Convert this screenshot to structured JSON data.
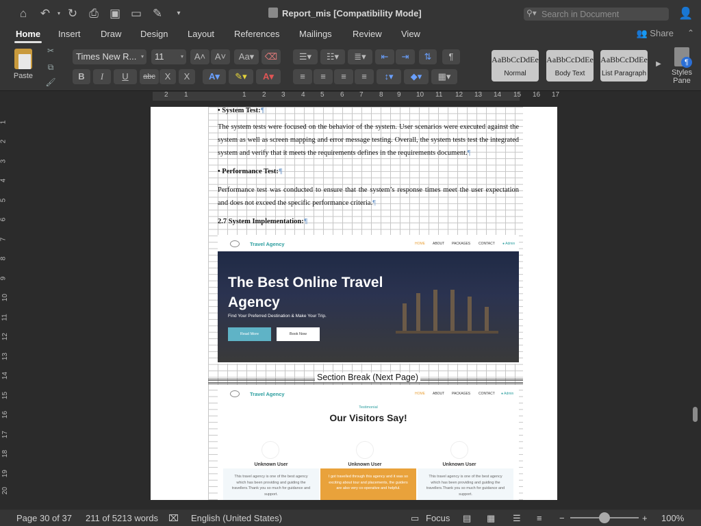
{
  "window": {
    "title": "Report_mis [Compatibility Mode]",
    "search_placeholder": "Search in Document"
  },
  "tabs": [
    "Home",
    "Insert",
    "Draw",
    "Design",
    "Layout",
    "References",
    "Mailings",
    "Review",
    "View"
  ],
  "active_tab": "Home",
  "share_label": "Share",
  "ribbon": {
    "paste_label": "Paste",
    "font_name": "Times New R...",
    "font_size": "11",
    "bold": "B",
    "italic": "I",
    "underline": "U",
    "strikethrough": "abc",
    "subscript": "X",
    "superscript": "X",
    "styles": [
      {
        "preview": "AaBbCcDdEe",
        "name": "Normal"
      },
      {
        "preview": "AaBbCcDdEe",
        "name": "Body Text"
      },
      {
        "preview": "AaBbCcDdEe",
        "name": "List Paragraph"
      }
    ],
    "styles_pane_line1": "Styles",
    "styles_pane_line2": "Pane"
  },
  "ruler_numbers": [
    "2",
    "1",
    "1",
    "2",
    "3",
    "4",
    "5",
    "6",
    "7",
    "8",
    "9",
    "10",
    "11",
    "12",
    "13",
    "14",
    "15",
    "16",
    "17"
  ],
  "vruler_numbers": [
    "1",
    "2",
    "3",
    "4",
    "5",
    "6",
    "7",
    "8",
    "9",
    "10",
    "11",
    "12",
    "13",
    "14",
    "15",
    "16",
    "17",
    "18",
    "19",
    "20"
  ],
  "document": {
    "system_test_heading": "• System Test:",
    "system_test_body": "The system tests were focused on the behavior of the system. User scenarios were executed against the system as well as screen mapping and error message testing. Overall, the system tests test the integrated system and verify that it meets the requirements defines in the requirements document.",
    "perf_test_heading": "• Performance Test:",
    "perf_test_body": "Performance test was conducted to ensure that the system’s response times meet the user expectation and does not exceed the specific performance criteria.",
    "impl_heading": "2.7 System Implementation:",
    "section_break": "Section Break (Next Page)",
    "pilcrow": "¶"
  },
  "website_shot1": {
    "brand": "Travel Agency",
    "nav_links": [
      "HOME",
      "ABOUT",
      "PACKAGES",
      "CONTACT"
    ],
    "admin": "Admin",
    "hero_title": "The Best Online Travel Agency",
    "hero_subtitle": "Find Your Preferred Destination & Make Your Trip.",
    "btn_read_more": "Read More",
    "btn_book_now": "Book Now"
  },
  "website_shot2": {
    "brand": "Travel Agency",
    "nav_links": [
      "HOME",
      "ABOUT",
      "PACKAGES",
      "CONTACT"
    ],
    "admin": "Admin",
    "section_label": "Testimonial",
    "section_title": "Our Visitors Say!",
    "users": [
      "Unknown User",
      "Unknown User",
      "Unknown User"
    ],
    "cards": [
      "This travel agency is one of the best agency which has been providing and guiding the travellers.Thank you so much for guidance and support.",
      "I got travelled through this agency and it was so exciting about tour and placements, the guiders are also very co-operative and helpful.",
      "This travel agency is one of the best agency which has been providing and guiding the travellers.Thank you so much for guidance and support."
    ]
  },
  "status": {
    "page": "Page 30 of 37",
    "words": "211 of 5213 words",
    "language": "English (United States)",
    "focus": "Focus",
    "zoom": "100%"
  },
  "colors": {
    "accent_teal": "#2a9d9e",
    "card_orange": "#e9a23b",
    "btn_teal": "#5fb3c6"
  }
}
